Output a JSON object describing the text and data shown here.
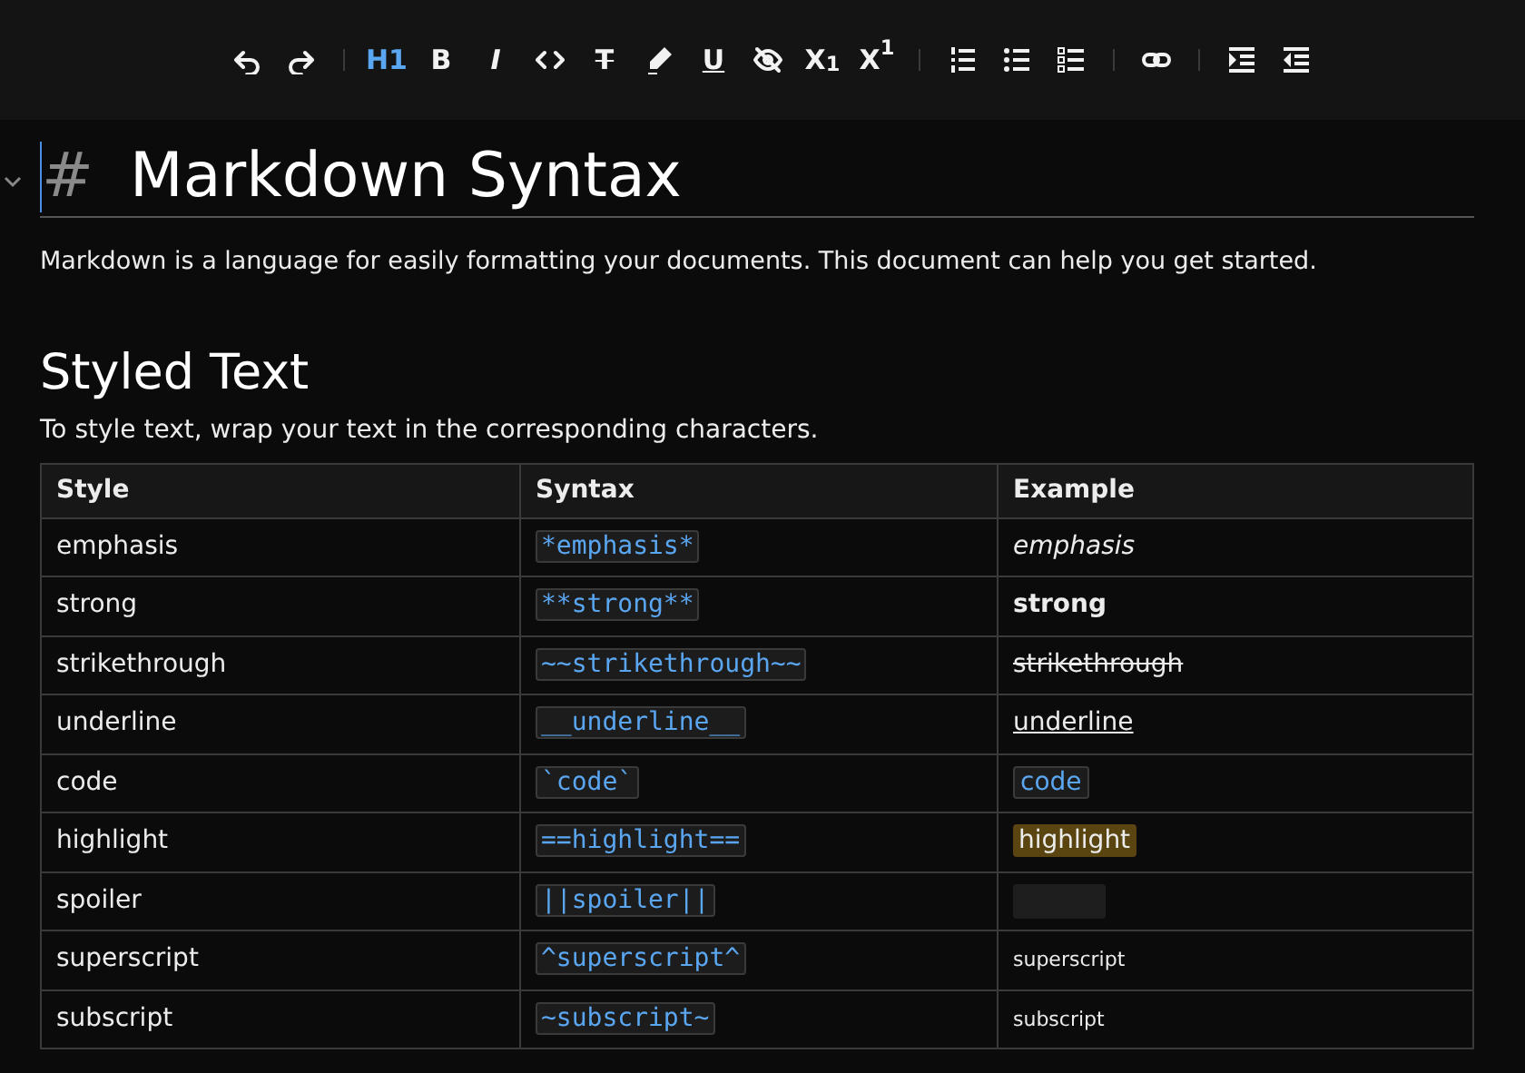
{
  "toolbar": [
    {
      "kind": "icon",
      "active": false
    },
    {
      "kind": "icon",
      "active": false
    },
    {
      "kind": "separator"
    },
    {
      "kind": "text",
      "label": "H1",
      "active": true
    },
    {
      "kind": "text",
      "label": "B",
      "active": false
    },
    {
      "kind": "text",
      "label": "I",
      "active": false
    },
    {
      "kind": "icon",
      "active": false
    },
    {
      "kind": "text",
      "label": "T",
      "active": false
    },
    {
      "kind": "icon",
      "active": false
    },
    {
      "kind": "text",
      "label": "U",
      "active": false
    },
    {
      "kind": "icon",
      "active": false
    },
    {
      "kind": "text",
      "label": "X$_{1}$",
      "active": false
    },
    {
      "kind": "text",
      "label": "X$^{1}$",
      "active": false
    },
    {
      "kind": "separator"
    },
    {
      "kind": "icon",
      "active": false
    },
    {
      "kind": "icon",
      "active": false
    },
    {
      "kind": "icon",
      "active": false
    },
    {
      "kind": "separator"
    },
    {
      "kind": "icon",
      "active": false
    },
    {
      "kind": "separator"
    },
    {
      "kind": "icon",
      "active": false
    },
    {
      "kind": "icon",
      "active": false
    }
  ],
  "document": {
    "heading": {
      "marker": "#",
      "text": "Markdown Syntax",
      "expanded": true
    },
    "intro": "Markdown is a language for easily formatting your documents. This document can help you get started.",
    "section": {
      "title": "Styled Text",
      "text": "To style text, wrap your text in the corresponding characters."
    },
    "table": {
      "columns": [
        "Style",
        "Syntax",
        "Example"
      ],
      "rows": [
        {
          "name": "emphasis",
          "syntax": "*emphasis*",
          "kind": "italic",
          "example": "emphasis"
        },
        {
          "name": "strong",
          "syntax": "**strong**",
          "kind": "bold",
          "example": "strong"
        },
        {
          "name": "strikethrough",
          "syntax": "~~strikethrough~~",
          "kind": "strike",
          "example": "strikethrough"
        },
        {
          "name": "underline",
          "syntax": "__underline__",
          "kind": "underline",
          "example": "underline"
        },
        {
          "name": "code",
          "syntax": "`code`",
          "kind": "code",
          "example": "code"
        },
        {
          "name": "highlight",
          "syntax": "==highlight==",
          "kind": "highlight",
          "example": "highlight"
        },
        {
          "name": "spoiler",
          "syntax": "||spoiler||",
          "kind": "spoiler"
        },
        {
          "name": "superscript",
          "syntax": "^superscript^",
          "kind": "small",
          "example": "superscript"
        },
        {
          "name": "subscript",
          "syntax": "~subscript~",
          "kind": "small",
          "example": "subscript"
        }
      ]
    }
  }
}
